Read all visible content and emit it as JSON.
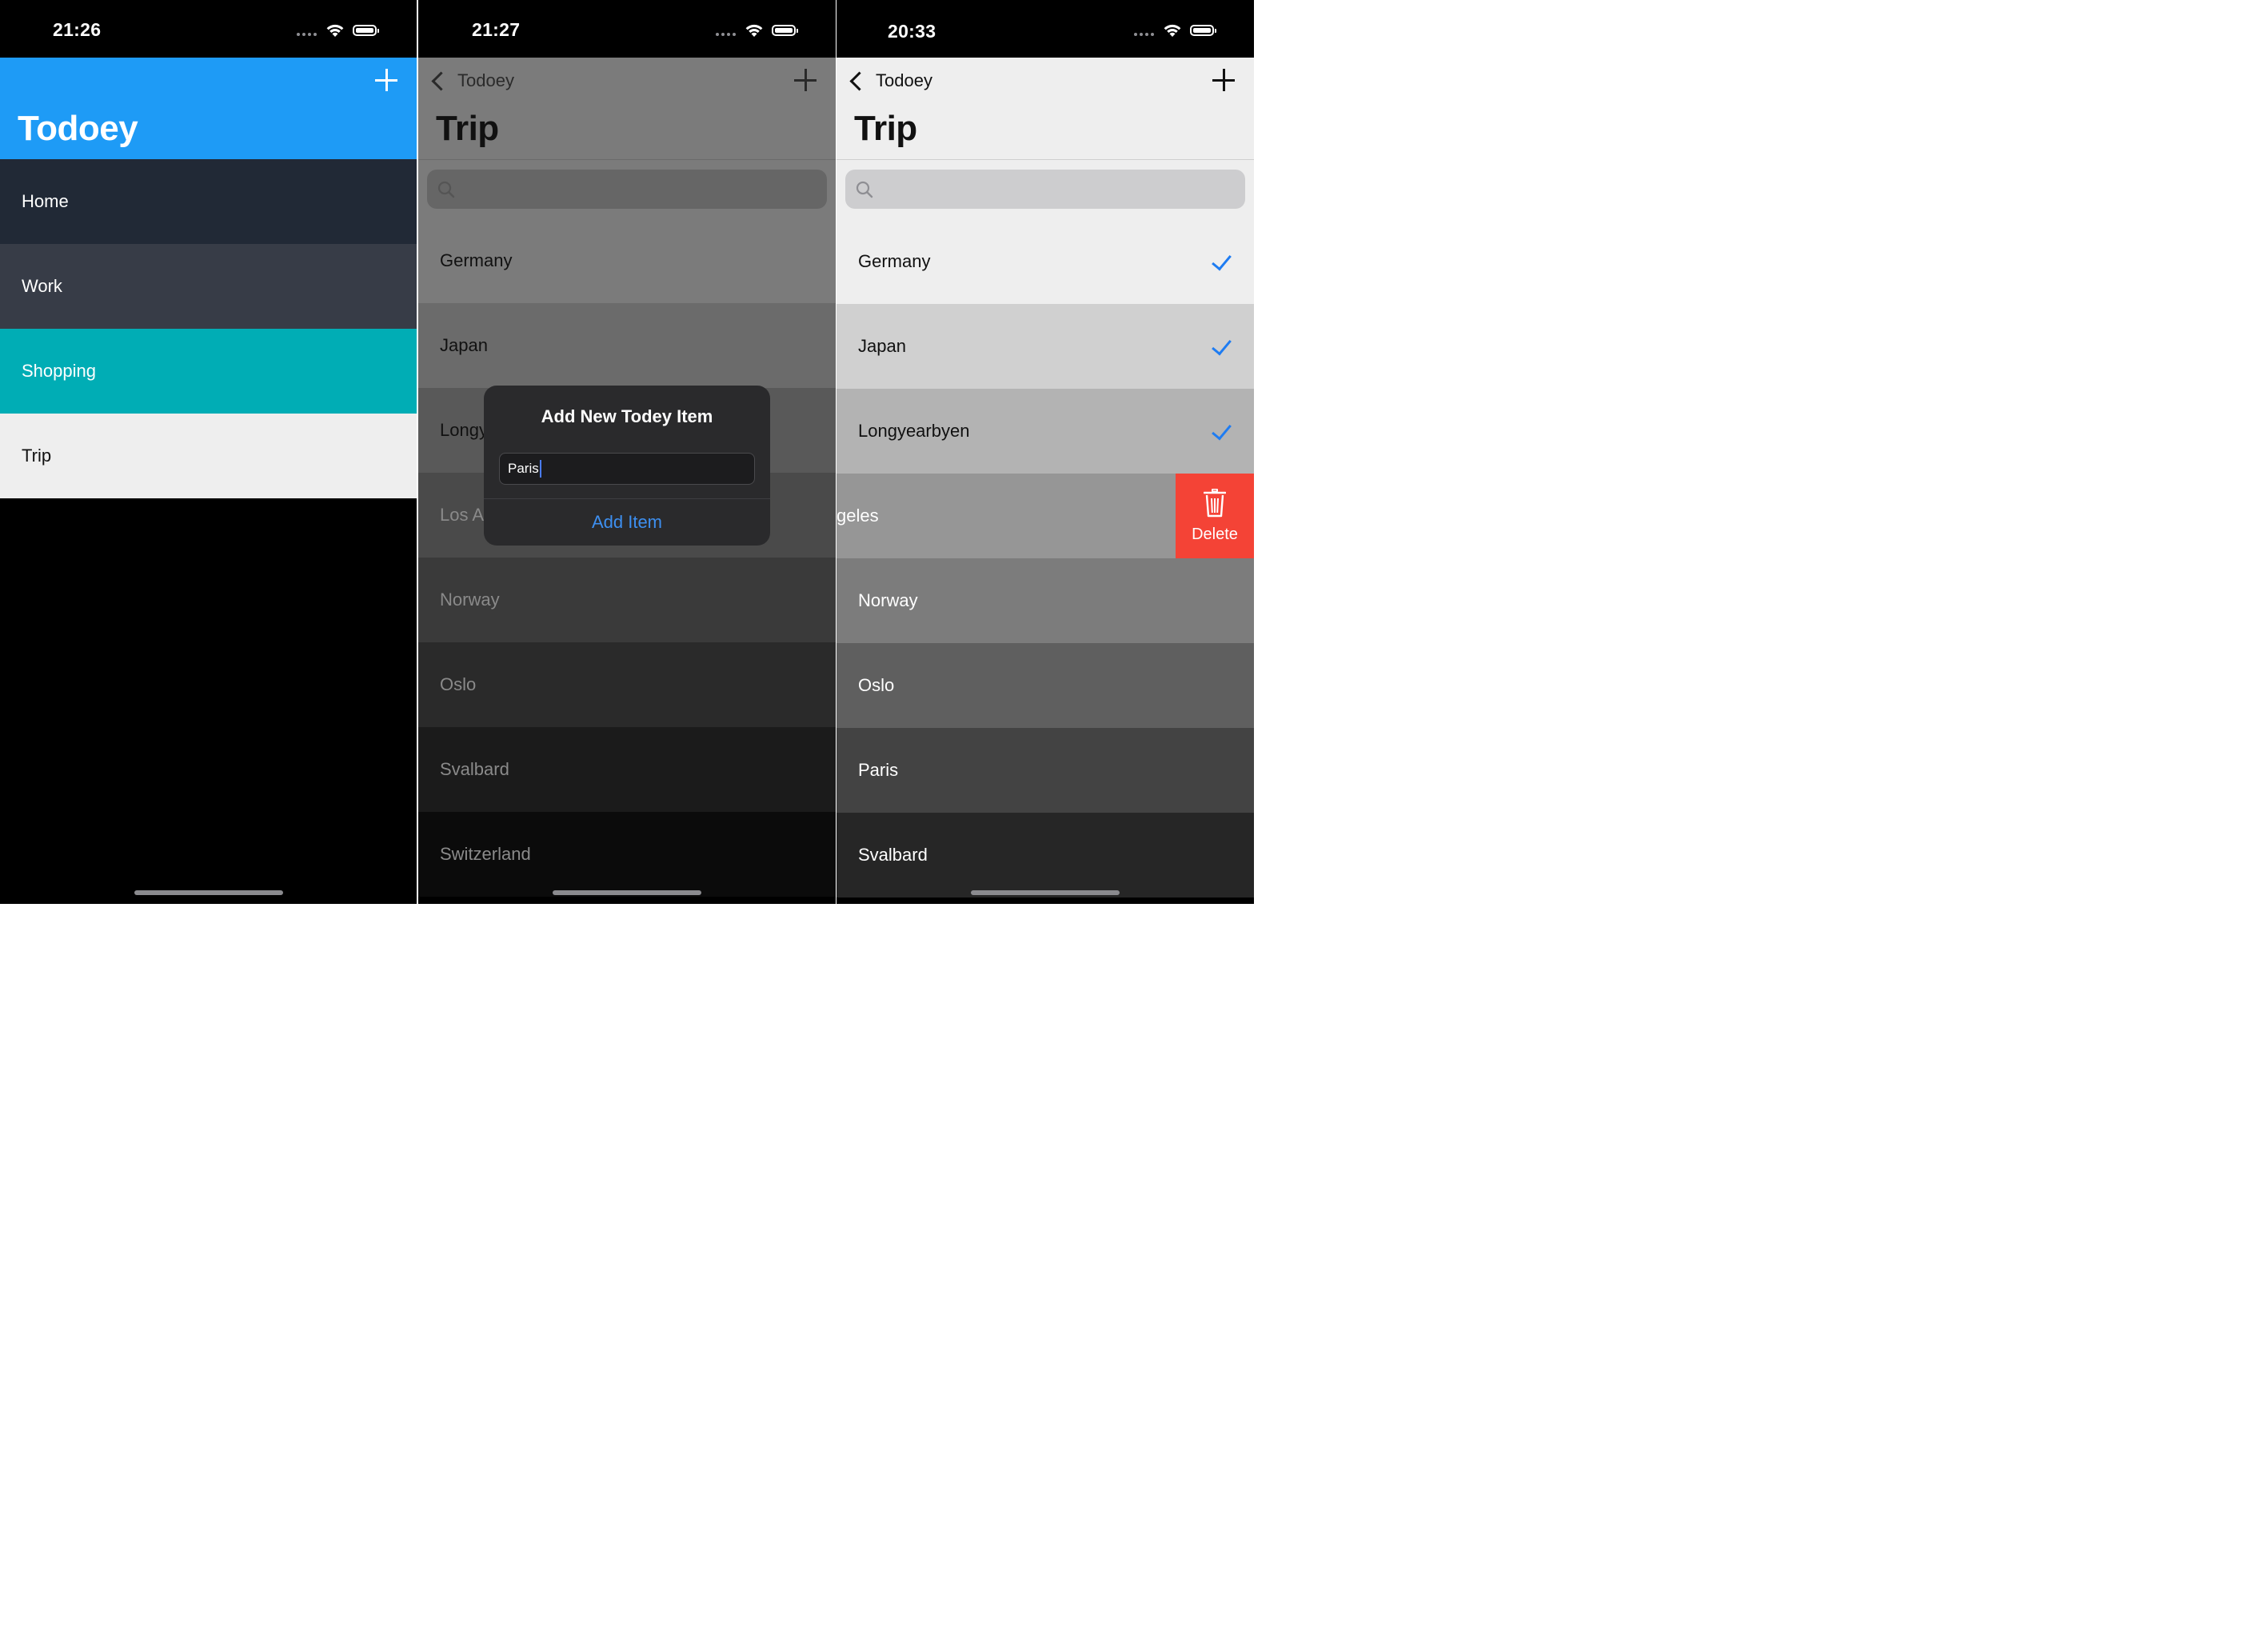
{
  "colors": {
    "nav_blue": "#1e9bf6",
    "checkmark": "#1e7cf2",
    "delete_red": "#f44336",
    "alert_button": "#3d8ff0"
  },
  "screens": [
    {
      "status": {
        "time": "21:26"
      },
      "nav": {
        "title": "Todoey",
        "add_icon": "plus-icon"
      },
      "categories": [
        {
          "label": "Home",
          "bg": "#212936",
          "fg": "#ffffff"
        },
        {
          "label": "Work",
          "bg": "#373c47",
          "fg": "#ffffff"
        },
        {
          "label": "Shopping",
          "bg": "#00adb5",
          "fg": "#ffffff"
        },
        {
          "label": "Trip",
          "bg": "#eeeeee",
          "fg": "#111111"
        }
      ]
    },
    {
      "status": {
        "time": "21:27"
      },
      "nav": {
        "back_label": "Todoey",
        "title": "Trip",
        "add_icon": "plus-icon"
      },
      "items": [
        {
          "label": "Germany",
          "bg": "#7b7b7b",
          "fg": "#111111"
        },
        {
          "label": "Japan",
          "bg": "#6b6b6b",
          "fg": "#111111"
        },
        {
          "label": "Longy",
          "bg": "#595959",
          "fg": "#111111"
        },
        {
          "label": "Los A",
          "bg": "#4a4a4a",
          "fg": "#8a8a8a"
        },
        {
          "label": "Norway",
          "bg": "#3a3a3a",
          "fg": "#8a8a8a"
        },
        {
          "label": "Oslo",
          "bg": "#2a2a2a",
          "fg": "#8a8a8a"
        },
        {
          "label": "Svalbard",
          "bg": "#1b1b1b",
          "fg": "#8a8a8a"
        },
        {
          "label": "Switzerland",
          "bg": "#0b0b0b",
          "fg": "#8a8a8a"
        }
      ],
      "alert": {
        "title": "Add New Todey Item",
        "field_value": "Paris",
        "button": "Add Item"
      }
    },
    {
      "status": {
        "time": "20:33"
      },
      "nav": {
        "back_label": "Todoey",
        "title": "Trip",
        "add_icon": "plus-icon"
      },
      "items": [
        {
          "label": "Germany",
          "bg": "#eeeeee",
          "fg": "#111111",
          "checked": true
        },
        {
          "label": "Japan",
          "bg": "#d0d0d0",
          "fg": "#111111",
          "checked": true
        },
        {
          "label": "Longyearbyen",
          "bg": "#b3b3b3",
          "fg": "#111111",
          "checked": true
        },
        {
          "label": "geles",
          "bg": "#969696",
          "fg": "#ffffff",
          "checked": false
        },
        {
          "label": "Norway",
          "bg": "#7c7c7c",
          "fg": "#ffffff",
          "checked": false
        },
        {
          "label": "Oslo",
          "bg": "#5f5f5f",
          "fg": "#ffffff",
          "checked": false
        },
        {
          "label": "Paris",
          "bg": "#434343",
          "fg": "#ffffff",
          "checked": false
        },
        {
          "label": "Svalbard",
          "bg": "#262626",
          "fg": "#ffffff",
          "checked": false
        }
      ],
      "delete_action": {
        "label": "Delete",
        "icon": "trash-icon"
      }
    }
  ]
}
